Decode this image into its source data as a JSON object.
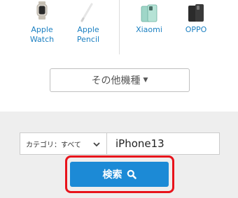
{
  "brands": [
    {
      "label_line1": "Apple",
      "label_line2": "Watch",
      "icon": "apple-watch-icon"
    },
    {
      "label_line1": "Apple",
      "label_line2": "Pencil",
      "icon": "apple-pencil-icon"
    },
    {
      "label_line1": "Xiaomi",
      "label_line2": "",
      "icon": "xiaomi-phone-icon"
    },
    {
      "label_line1": "OPPO",
      "label_line2": "",
      "icon": "oppo-phone-icon"
    }
  ],
  "more_models": {
    "label": "その他機種",
    "icon": "caret-down-icon"
  },
  "search": {
    "category_label": "カテゴリ：すべて",
    "query_value": "iPhone13",
    "button_label": "検索",
    "button_icon": "search-icon"
  },
  "colors": {
    "link": "#1a7fc1",
    "button": "#1c8ad6",
    "highlight": "#e8131b",
    "search_bg": "#eeeeee"
  }
}
